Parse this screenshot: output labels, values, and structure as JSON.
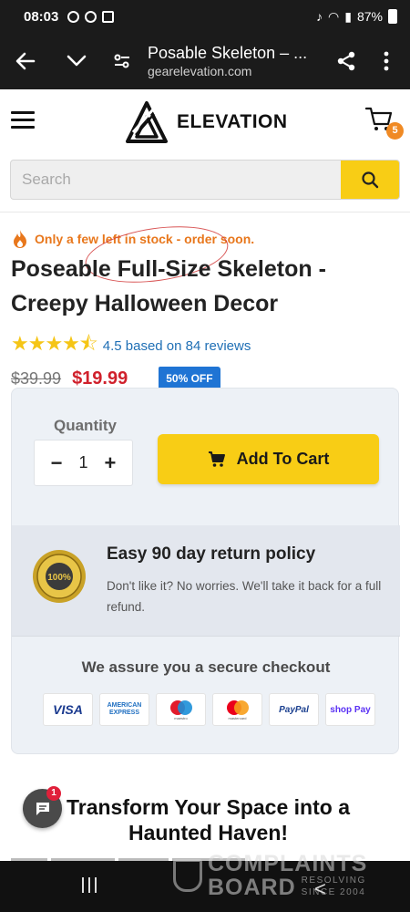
{
  "status_bar": {
    "time": "08:03",
    "battery": "87%"
  },
  "browser": {
    "page_title": "Posable Skeleton – ...",
    "domain": "gearelevation.com"
  },
  "header": {
    "logo_text": "ELEVATION",
    "cart_count": "5"
  },
  "search": {
    "placeholder": "Search"
  },
  "product": {
    "stock_alert": "Only a few left in stock - order soon.",
    "title": "Poseable Full-Size Skeleton - Creepy Halloween Decor",
    "rating_value": 4.5,
    "rating_text": "4.5 based on 84 reviews",
    "old_price": "$39.99",
    "new_price": "$19.99",
    "discount_badge": "50% OFF"
  },
  "purchase": {
    "quantity_label": "Quantity",
    "quantity_value": "1",
    "add_to_cart_label": "Add To Cart"
  },
  "return_policy": {
    "title": "Easy 90 day return policy",
    "text": "Don't like it? No worries. We'll take it back for a full refund."
  },
  "secure_checkout": {
    "heading": "We assure you a secure checkout",
    "payment_methods": [
      "VISA",
      "AMERICAN EXPRESS",
      "maestro",
      "mastercard",
      "PayPal",
      "shop Pay"
    ]
  },
  "section": {
    "heading": "Transform Your Space into a Haunted Haven!"
  },
  "chat": {
    "badge_count": "1"
  },
  "watermark": {
    "line1": "COMPLAINTS",
    "line2": "BOARD",
    "tag1": "RESOLVING",
    "tag2": "SINCE 2004"
  },
  "colors": {
    "accent_yellow": "#f8cd15",
    "price_red": "#d0212c",
    "stock_orange": "#e8771c",
    "link_blue": "#1f6fb5",
    "badge_blue": "#1f74d4"
  }
}
